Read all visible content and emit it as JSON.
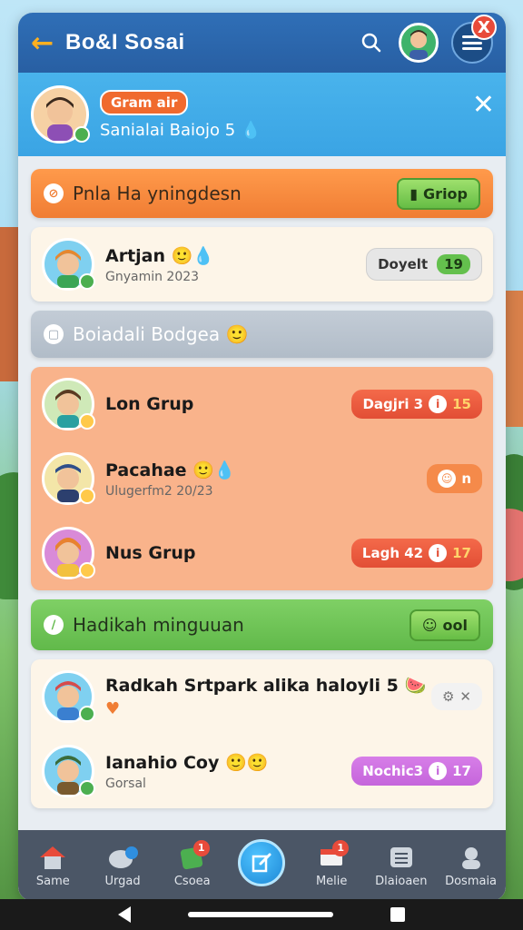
{
  "appbar": {
    "title": "Bo&I Sosai"
  },
  "profile": {
    "pill": "Gram air",
    "subtitle": "Sanialai Baiojo 5 💧"
  },
  "sections": {
    "first": {
      "title": "Pnla Ha yningdesn",
      "button": "Griop"
    },
    "second": {
      "title": "Boiadali Bodgea 🙂"
    },
    "third": {
      "title": "Hadikah minguuan",
      "button": "ool"
    }
  },
  "rows": [
    {
      "name": "Artjan 🙂💧",
      "sub": "Gnyamin 2023",
      "pill_label": "Doyelt",
      "pill_value": "19"
    },
    {
      "name": "Lon Grup",
      "sub": "",
      "pill_label": "Dagjri 3",
      "pill_value": "15"
    },
    {
      "name": "Pacahae 🙂💧",
      "sub": "Ulugerfm2 20/23",
      "pill_label": "",
      "pill_value": "n"
    },
    {
      "name": "Nus Grup",
      "sub": "",
      "pill_label": "Lagh 42",
      "pill_value": "17"
    },
    {
      "name": "Radkah Srtpark alika haloyli 5 🍉",
      "sub": "",
      "pill_label": "",
      "pill_value": "✕"
    },
    {
      "name": "Ianahio Coy 🙂🙂",
      "sub": "Gorsal",
      "pill_label": "Nochic3",
      "pill_value": "17"
    }
  ],
  "nav": [
    {
      "label": "Same"
    },
    {
      "label": "Urgad"
    },
    {
      "label": "Csoea",
      "badge": "1"
    },
    {
      "label": ""
    },
    {
      "label": "Melie",
      "badge": "1"
    },
    {
      "label": "Dlaioaen"
    },
    {
      "label": "Dosmaia"
    }
  ],
  "notifications": {
    "count": "X"
  }
}
